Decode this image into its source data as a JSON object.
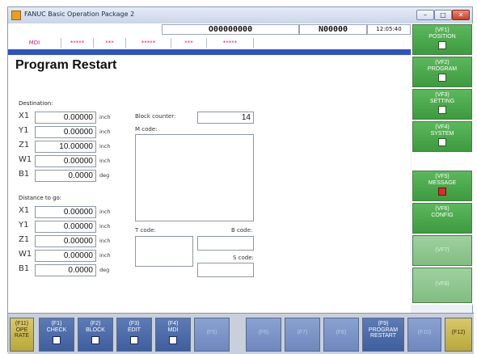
{
  "window": {
    "title": "FANUC Basic Operation Package 2"
  },
  "status_bar": {
    "program": "O00000000",
    "sequence": "N00000",
    "time": "12:05:40"
  },
  "mode_line": {
    "cells": [
      "MDI",
      "*****",
      "***",
      "*****",
      "***",
      "*****"
    ]
  },
  "page_title": "Program Restart",
  "destination": {
    "label": "Destination:",
    "axes": [
      {
        "name": "X1",
        "value": "0.00000",
        "unit": "inch"
      },
      {
        "name": "Y1",
        "value": "0.00000",
        "unit": "inch"
      },
      {
        "name": "Z1",
        "value": "10.00000",
        "unit": "inch"
      },
      {
        "name": "W1",
        "value": "0.00000",
        "unit": "inch"
      },
      {
        "name": "B1",
        "value": "0.0000",
        "unit": "deg"
      }
    ]
  },
  "distance_to_go": {
    "label": "Distance to go:",
    "axes": [
      {
        "name": "X1",
        "value": "0.00000",
        "unit": "inch"
      },
      {
        "name": "Y1",
        "value": "0.00000",
        "unit": "inch"
      },
      {
        "name": "Z1",
        "value": "0.00000",
        "unit": "inch"
      },
      {
        "name": "W1",
        "value": "0.00000",
        "unit": "inch"
      },
      {
        "name": "B1",
        "value": "0.0000",
        "unit": "deg"
      }
    ]
  },
  "block_counter": {
    "label": "Block counter:",
    "value": "14"
  },
  "codes": {
    "m_label": "M code:",
    "t_label": "T code:",
    "b_label": "B code:",
    "s_label": "S code:"
  },
  "vertical_softkeys": [
    {
      "key": "(VF1)",
      "label": "POSITION",
      "icon": "position-grid-icon"
    },
    {
      "key": "(VF2)",
      "label": "PROGRAM",
      "icon": "program-icon"
    },
    {
      "key": "(VF3)",
      "label": "SETTING",
      "icon": "setting-icon"
    },
    {
      "key": "(VF4)",
      "label": "SYSTEM",
      "icon": "system-icon"
    },
    {
      "key": "(VF5)",
      "label": "MESSAGE",
      "icon": "message-icon"
    },
    {
      "key": "(VF6)",
      "label": "CONFIG",
      "icon": ""
    },
    {
      "key": "(VF7)",
      "label": "",
      "icon": ""
    },
    {
      "key": "(VF8)",
      "label": "",
      "icon": ""
    }
  ],
  "function_keys": [
    {
      "key": "(F11)",
      "label": "OPE RATE"
    },
    {
      "key": "(F1)",
      "label": "CHECK"
    },
    {
      "key": "(F2)",
      "label": "BLOCK"
    },
    {
      "key": "(F3)",
      "label": "EDIT"
    },
    {
      "key": "(F4)",
      "label": "MDI"
    },
    {
      "key": "(F5)",
      "label": ""
    },
    {
      "key": "(F6)",
      "label": ""
    },
    {
      "key": "(F7)",
      "label": ""
    },
    {
      "key": "(F8)",
      "label": ""
    },
    {
      "key": "(F9)",
      "label": "PROGRAM RESTART"
    },
    {
      "key": "(F10)",
      "label": ""
    },
    {
      "key": "(F12)",
      "label": ""
    }
  ]
}
